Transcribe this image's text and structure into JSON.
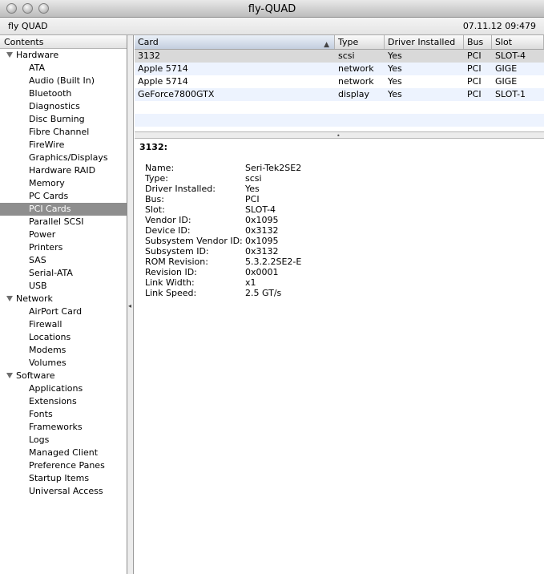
{
  "window": {
    "title": "fly-QUAD"
  },
  "infobar": {
    "machine_name": "fly QUAD",
    "datetime": "07.11.12 09:479"
  },
  "sidebar": {
    "header": "Contents",
    "groups": [
      {
        "label": "Hardware",
        "items": [
          "ATA",
          "Audio (Built In)",
          "Bluetooth",
          "Diagnostics",
          "Disc Burning",
          "Fibre Channel",
          "FireWire",
          "Graphics/Displays",
          "Hardware RAID",
          "Memory",
          "PC Cards",
          "PCI Cards",
          "Parallel SCSI",
          "Power",
          "Printers",
          "SAS",
          "Serial-ATA",
          "USB"
        ]
      },
      {
        "label": "Network",
        "items": [
          "AirPort Card",
          "Firewall",
          "Locations",
          "Modems",
          "Volumes"
        ]
      },
      {
        "label": "Software",
        "items": [
          "Applications",
          "Extensions",
          "Fonts",
          "Frameworks",
          "Logs",
          "Managed Client",
          "Preference Panes",
          "Startup Items",
          "Universal Access"
        ]
      }
    ],
    "selected": "PCI Cards"
  },
  "table": {
    "columns": [
      "Card",
      "Type",
      "Driver Installed",
      "Bus",
      "Slot"
    ],
    "sort_column": "Card",
    "rows": [
      [
        "3132",
        "scsi",
        "Yes",
        "PCI",
        "SLOT-4"
      ],
      [
        "Apple 5714",
        "network",
        "Yes",
        "PCI",
        "GIGE"
      ],
      [
        "Apple 5714",
        "network",
        "Yes",
        "PCI",
        "GIGE"
      ],
      [
        "GeForce7800GTX",
        "display",
        "Yes",
        "PCI",
        "SLOT-1"
      ]
    ],
    "selected_row": 0
  },
  "detail": {
    "heading": "3132:",
    "properties": [
      [
        "Name:",
        "Seri-Tek2SE2"
      ],
      [
        "Type:",
        "scsi"
      ],
      [
        "Driver Installed:",
        "Yes"
      ],
      [
        "Bus:",
        "PCI"
      ],
      [
        "Slot:",
        "SLOT-4"
      ],
      [
        "Vendor ID:",
        "0x1095"
      ],
      [
        "Device ID:",
        "0x3132"
      ],
      [
        "Subsystem Vendor ID:",
        "0x1095"
      ],
      [
        "Subsystem ID:",
        "0x3132"
      ],
      [
        "ROM Revision:",
        "5.3.2.2SE2-E"
      ],
      [
        "Revision ID:",
        "0x0001"
      ],
      [
        "Link Width:",
        "x1"
      ],
      [
        "Link Speed:",
        "2.5 GT/s"
      ]
    ]
  },
  "colors": {
    "selection_gray": "#8e8e8e",
    "row_alt": "#edf3fe"
  }
}
